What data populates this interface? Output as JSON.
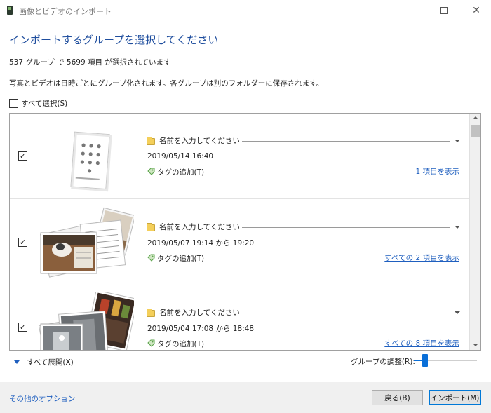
{
  "window": {
    "title": "画像とビデオのインポート"
  },
  "heading": "インポートするグループを選択してください",
  "summary": {
    "count_text": "537 グループ で 5699 項目 が選択されています"
  },
  "description": "写真とビデオは日時ごとにグループ化されます。各グループは別のフォルダーに保存されます。",
  "select_all": {
    "label": "すべて選択(S)",
    "checked": false
  },
  "groups": [
    {
      "checked": true,
      "name_placeholder": "名前を入力してください",
      "date": "2019/05/14 16:40",
      "tag_label": "タグの追加(T)",
      "view_link": "1 項目を表示",
      "thumbnail_icon": "document-photo"
    },
    {
      "checked": true,
      "name_placeholder": "名前を入力してください",
      "date": "2019/05/07 19:14 から 19:20",
      "tag_label": "タグの追加(T)",
      "view_link": "すべての 2 項目を表示",
      "thumbnail_icon": "photo-stack"
    },
    {
      "checked": true,
      "name_placeholder": "名前を入力してください",
      "date": "2019/05/04 17:08 から 18:48",
      "tag_label": "タグの追加(T)",
      "view_link": "すべての 8 項目を表示",
      "thumbnail_icon": "photo-stack"
    }
  ],
  "bottom": {
    "expand_all": "すべて展開(X)",
    "group_adjust_label": "グループの調整(R):",
    "group_adjust_value": 0.15
  },
  "footer": {
    "more_options": "その他のオプション",
    "back_button": "戻る(B)",
    "import_button": "インポート(M)"
  },
  "colors": {
    "accent": "#0a6fd8",
    "heading": "#1f4e9e",
    "link": "#1f5fbf",
    "footer_bg": "#f0f0f0"
  }
}
